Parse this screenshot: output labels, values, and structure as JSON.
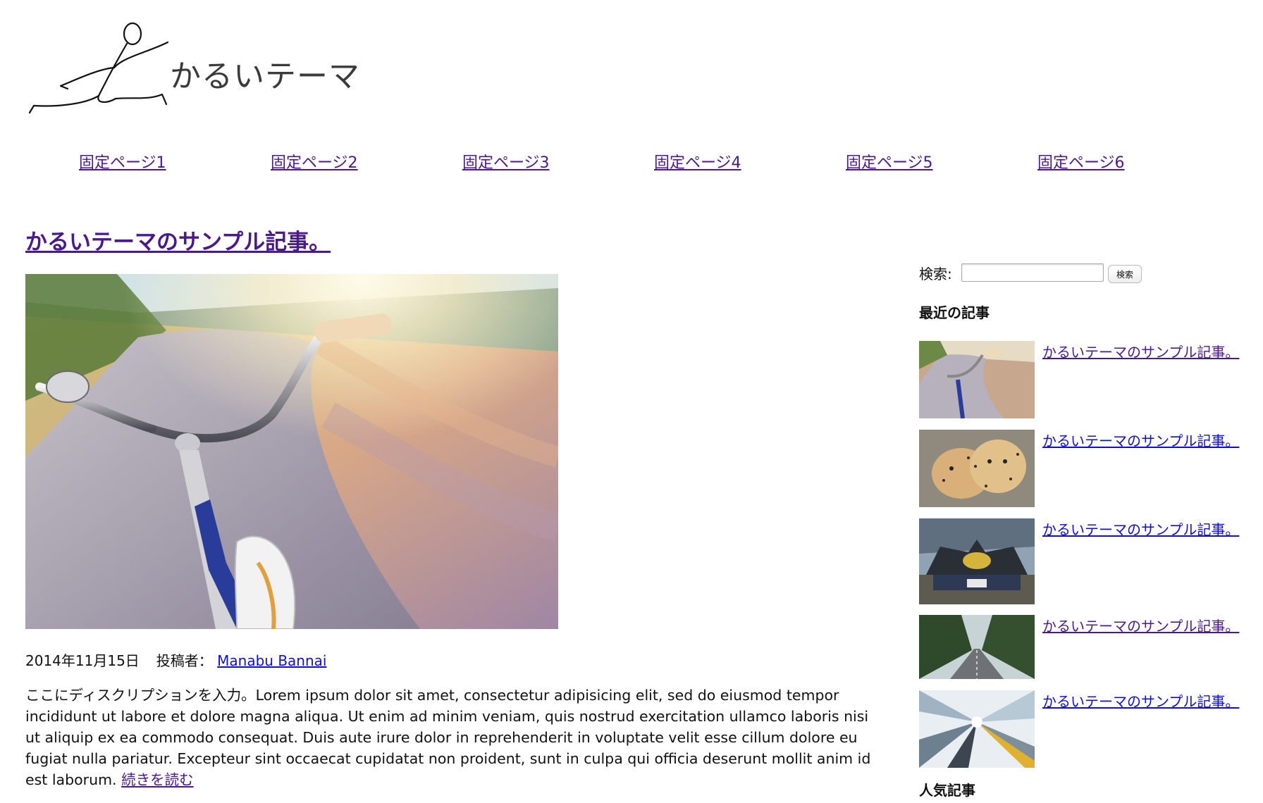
{
  "site": {
    "logo_text": "かるいテーマ",
    "logo_icon": "running-stick-figure"
  },
  "nav": {
    "items": [
      "固定ページ1",
      "固定ページ2",
      "固定ページ3",
      "固定ページ4",
      "固定ページ5",
      "固定ページ6"
    ]
  },
  "post": {
    "title": "かるいテーマのサンプル記事。",
    "image": "bicycle-handlebar-motion-blur",
    "date": "2014年11月15日",
    "author_label": "投稿者：",
    "author": "Manabu Bannai",
    "excerpt": "ここにディスクリプションを入力。Lorem ipsum dolor sit amet, consectetur adipisicing elit, sed do eiusmod tempor incididunt ut labore et dolore magna aliqua. Ut enim ad minim veniam, quis nostrud exercitation ullamco laboris nisi ut aliquip ex ea commodo consequat. Duis aute irure dolor in reprehenderit in voluptate velit esse cillum dolore eu fugiat nulla pariatur. Excepteur sint occaecat cupidatat non proident, sunt in culpa qui officia deserunt mollit anim id est laborum. ",
    "read_more": "続きを読む"
  },
  "sidebar": {
    "search_label": "検索:",
    "search_value": "",
    "search_button": "検索",
    "recent_title": "最近の記事",
    "recent": [
      {
        "title": "かるいテーマのサンプル記事。",
        "thumb": "bicycle-thumbnail"
      },
      {
        "title": "かるいテーマのサンプル記事。",
        "thumb": "cheetahs-thumbnail"
      },
      {
        "title": "かるいテーマのサンプル記事。",
        "thumb": "car-rear-thumbnail"
      },
      {
        "title": "かるいテーマのサンプル記事。",
        "thumb": "forest-road-thumbnail"
      },
      {
        "title": "かるいテーマのサンプル記事。",
        "thumb": "light-tunnel-thumbnail"
      }
    ],
    "popular_title": "人気記事"
  },
  "colors": {
    "visited_link": "#4a1a8a",
    "unvisited_link": "#1010cc",
    "text": "#111111"
  }
}
